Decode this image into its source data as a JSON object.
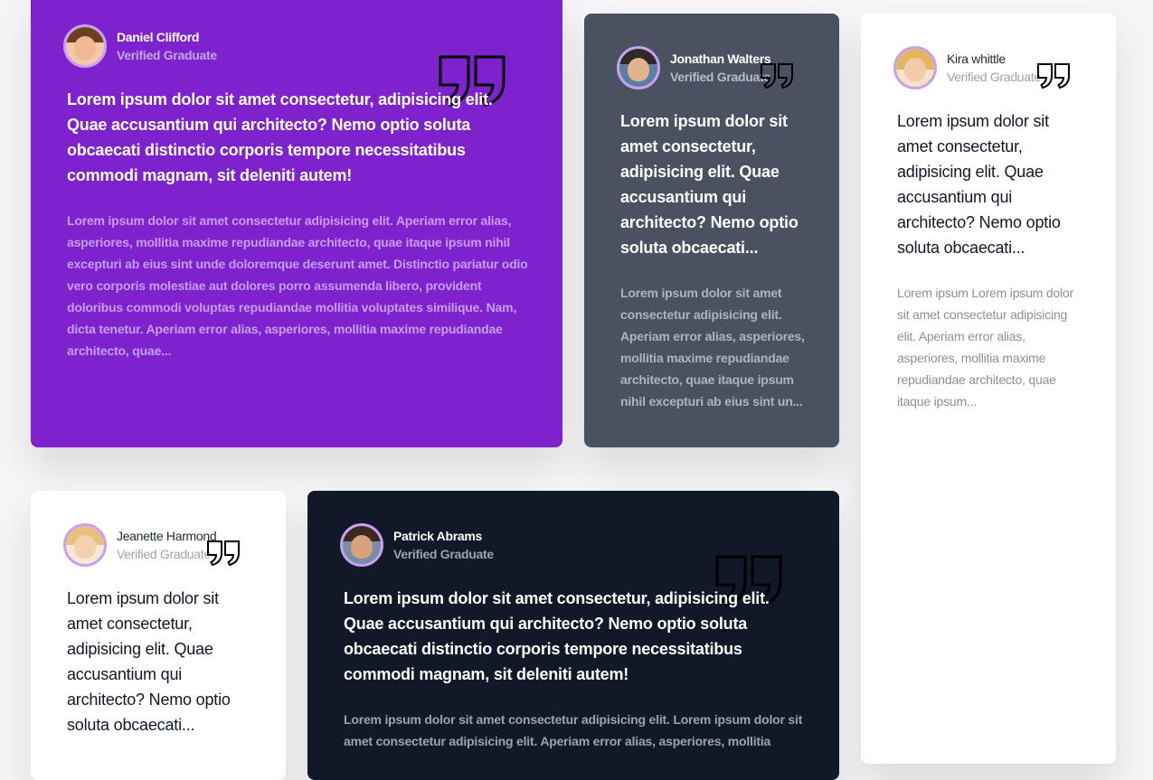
{
  "colors": {
    "purple_card": "#7e22ce",
    "slate_card": "#4a5261",
    "white_card": "#ffffff",
    "dark_card": "#111827",
    "avatar_ring": "#c9a0f2"
  },
  "testimonials": [
    {
      "name": "Daniel Clifford",
      "role": "Verified Graduate",
      "icon": "quotation-mark-icon",
      "lead": "Lorem ipsum dolor sit amet consectetur, adipisicing elit. Quae accusantium qui architecto? Nemo optio soluta obcaecati distinctio corporis tempore necessitatibus commodi magnam, sit deleniti autem!",
      "body": "Lorem ipsum dolor sit amet consectetur adipisicing elit. Aperiam error alias, asperiores, mollitia maxime repudiandae architecto, quae itaque ipsum nihil excepturi ab eius sint unde doloremque deserunt amet. Distinctio pariatur odio vero corporis molestiae aut dolores porro assumenda libero, provident doloribus commodi voluptas repudiandae mollitia voluptates similique. Nam, dicta tenetur. Aperiam error alias, asperiores, mollitia maxime repudiandae architecto, quae..."
    },
    {
      "name": "Jonathan Walters",
      "role": "Verified Graduate",
      "icon": "quotation-mark-icon",
      "lead": "Lorem ipsum dolor sit amet consectetur, adipisicing elit. Quae accusantium qui architecto? Nemo optio soluta obcaecati...",
      "body": "Lorem ipsum dolor sit amet consectetur adipisicing elit. Aperiam error alias, asperiores, mollitia maxime repudiandae architecto, quae itaque ipsum nihil excepturi ab eius sint un..."
    },
    {
      "name": "Kira whittle",
      "role": "Verified Graduate",
      "icon": "quotation-mark-icon",
      "lead": "Lorem ipsum dolor sit amet consectetur, adipisicing elit. Quae accusantium qui architecto? Nemo optio soluta obcaecati...",
      "body": "Lorem ipsum Lorem ipsum dolor sit amet consectetur adipisicing elit. Aperiam error alias, asperiores, mollitia maxime repudiandae architecto, quae itaque ipsum..."
    },
    {
      "name": "Jeanette Harmond",
      "role": "Verified Graduate",
      "icon": "quotation-mark-icon",
      "lead": "Lorem ipsum dolor sit amet consectetur, adipisicing elit. Quae accusantium qui architecto? Nemo optio soluta obcaecati...",
      "body": ""
    },
    {
      "name": "Patrick Abrams",
      "role": "Verified Graduate",
      "icon": "quotation-mark-icon",
      "lead": "Lorem ipsum dolor sit amet consectetur, adipisicing elit. Quae accusantium qui architecto? Nemo optio soluta obcaecati distinctio corporis tempore necessitatibus commodi magnam, sit deleniti autem!",
      "body": "Lorem ipsum dolor sit amet consectetur adipisicing elit. Lorem ipsum dolor sit amet consectetur adipisicing elit. Aperiam error alias, asperiores, mollitia"
    }
  ]
}
